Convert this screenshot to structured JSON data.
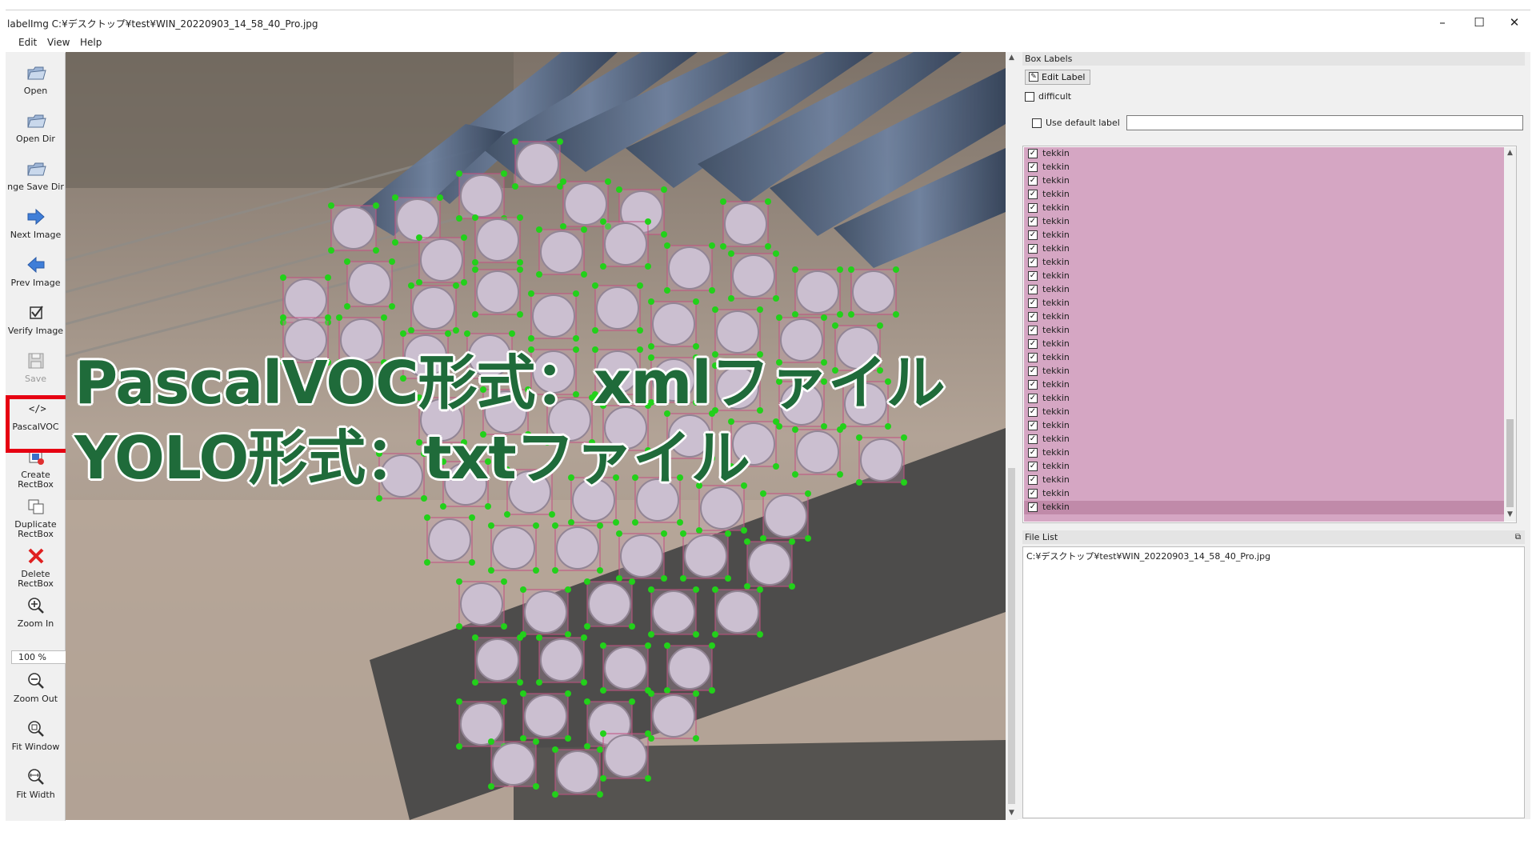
{
  "window": {
    "title": "labelImg C:¥デスクトップ¥test¥WIN_20220903_14_58_40_Pro.jpg",
    "controls": {
      "minimize": "–",
      "maximize": "☐",
      "close": "✕"
    }
  },
  "menu": {
    "items": [
      "Edit",
      "View",
      "Help"
    ]
  },
  "toolbar": {
    "items": [
      {
        "label": "Open",
        "icon": "folder-open-icon"
      },
      {
        "label": "Open Dir",
        "icon": "folder-open-icon"
      },
      {
        "label": "nge Save Dir",
        "icon": "folder-open-icon"
      },
      {
        "label": "Next Image",
        "icon": "arrow-right-icon"
      },
      {
        "label": "Prev Image",
        "icon": "arrow-left-icon"
      },
      {
        "label": "Verify Image",
        "icon": "checkbox-icon"
      },
      {
        "label": "Save",
        "icon": "save-icon"
      },
      {
        "label": "PascalVOC",
        "icon": "code-icon"
      },
      {
        "label": "Create\nRectBox",
        "icon": "create-rect-icon"
      },
      {
        "label": "Duplicate\nRectBox",
        "icon": "duplicate-rect-icon"
      },
      {
        "label": "Delete\nRectBox",
        "icon": "delete-x-icon"
      },
      {
        "label": "Zoom In",
        "icon": "zoom-in-icon"
      },
      {
        "label": "Zoom Out",
        "icon": "zoom-out-icon"
      },
      {
        "label": "Fit Window",
        "icon": "fit-window-icon"
      },
      {
        "label": "Fit Width",
        "icon": "fit-width-icon"
      }
    ],
    "zoom_value": "100 %"
  },
  "overlay": {
    "line1": "PascalVOC形式：xmlファイル",
    "line2": "YOLO形式：txtファイル"
  },
  "box_labels": {
    "title": "Box Labels",
    "edit_label_button": "Edit Label",
    "difficult_label": "difficult",
    "use_default_label": "Use default label",
    "default_label_value": "",
    "labels": [
      "tekkin",
      "tekkin",
      "tekkin",
      "tekkin",
      "tekkin",
      "tekkin",
      "tekkin",
      "tekkin",
      "tekkin",
      "tekkin",
      "tekkin",
      "tekkin",
      "tekkin",
      "tekkin",
      "tekkin",
      "tekkin",
      "tekkin",
      "tekkin",
      "tekkin",
      "tekkin",
      "tekkin",
      "tekkin",
      "tekkin",
      "tekkin",
      "tekkin",
      "tekkin",
      "tekkin"
    ],
    "selected_index": 26,
    "list_bg": "#d5a6c3"
  },
  "file_list": {
    "title": "File List",
    "files": [
      "C:¥デスクトップ¥test¥WIN_20220903_14_58_40_Pro.jpg"
    ]
  },
  "colors": {
    "highlight": "#e60012",
    "overlay_text": "#1f6b3a",
    "box_vertex": "#22d11a"
  }
}
